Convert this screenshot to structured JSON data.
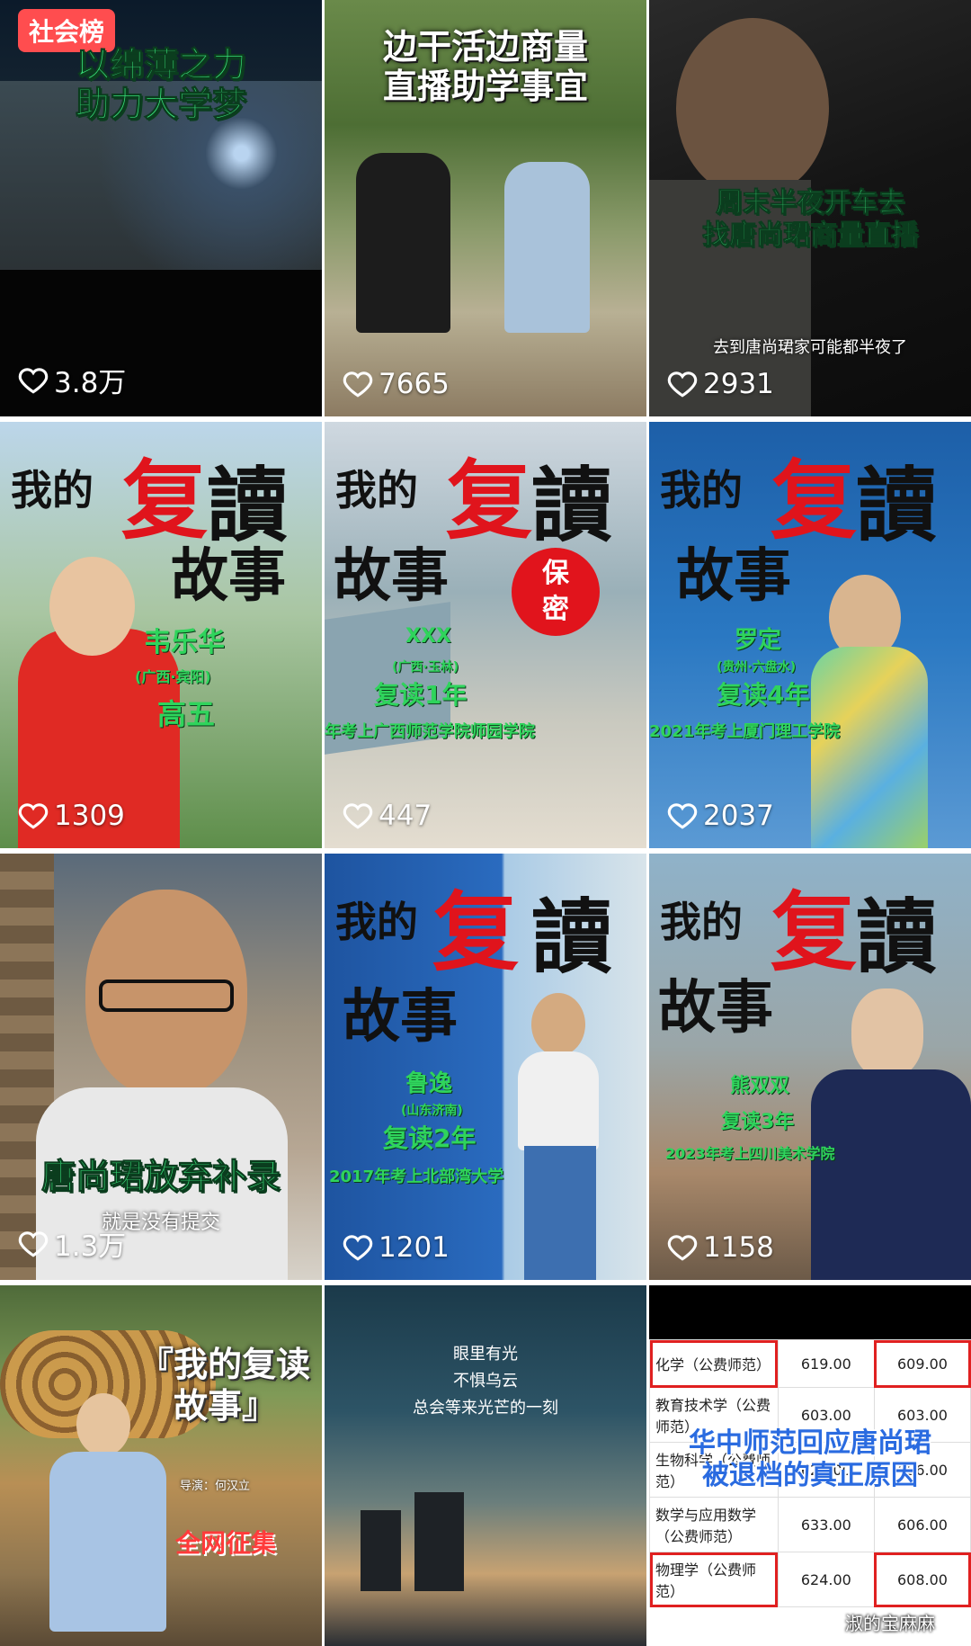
{
  "tiles": [
    {
      "badge": "社会榜",
      "caption": [
        "以绵薄之力",
        "助力大学梦"
      ],
      "likes": "3.8万"
    },
    {
      "caption": [
        "边干活边商量",
        "直播助学事宜"
      ],
      "likes": "7665"
    },
    {
      "caption": [
        "周末半夜开车去",
        "找唐尚珺商量直播"
      ],
      "subtitle": "去到唐尚珺家可能都半夜了",
      "likes": "2931"
    },
    {
      "title_a": "我的",
      "title_b": "复",
      "title_c": "讀",
      "title_d": "故事",
      "name": "韦乐华",
      "place": "(广西·宾阳)",
      "info": "高五",
      "likes": "1309"
    },
    {
      "title_a": "我的",
      "title_b": "复",
      "title_c": "讀",
      "title_d": "故事",
      "stamp": "保密",
      "name": "XXX",
      "place": "(广西·玉林)",
      "info": "复读1年",
      "school": "年考上广西师范学院师园学院",
      "likes": "447"
    },
    {
      "title_a": "我的",
      "title_b": "复",
      "title_c": "讀",
      "title_d": "故事",
      "name": "罗定",
      "place": "(贵州·六盘水)",
      "info": "复读4年",
      "school": "2021年考上厦门理工学院",
      "likes": "2037"
    },
    {
      "caption": "唐尚珺放弃补录",
      "subtitle": "就是没有提交",
      "likes": "1.3万"
    },
    {
      "title_a": "我的",
      "title_b": "复",
      "title_c": "讀",
      "title_d": "故事",
      "name": "鲁逸",
      "place": "(山东济南)",
      "info": "复读2年",
      "school": "2017年考上北部湾大学",
      "likes": "1201"
    },
    {
      "title_a": "我的",
      "title_b": "复",
      "title_c": "讀",
      "title_d": "故事",
      "name": "熊双双",
      "info": "复读3年",
      "school": "2023年考上四川美术学院",
      "likes": "1158"
    },
    {
      "title": "『我的复读故事』",
      "director": "导演：何汉立",
      "banner": "全网征集"
    },
    {
      "lines": [
        "眼里有光",
        "不惧乌云",
        "总会等来光芒的一刻"
      ]
    },
    {
      "headline": [
        "华中师范回应唐尚珺",
        "被退档的真正原因"
      ],
      "rows": [
        [
          "化学（公费师范）",
          "619.00",
          "609.00"
        ],
        [
          "教育技术学（公费师范）",
          "603.00",
          "603.00"
        ],
        [
          "生物科学（公费师范）",
          "629.00",
          "606.00"
        ],
        [
          "数学与应用数学（公费师范）",
          "633.00",
          "606.00"
        ],
        [
          "物理学（公费师范）",
          "624.00",
          "608.00"
        ]
      ],
      "watermark": "淑的宝麻麻"
    }
  ]
}
